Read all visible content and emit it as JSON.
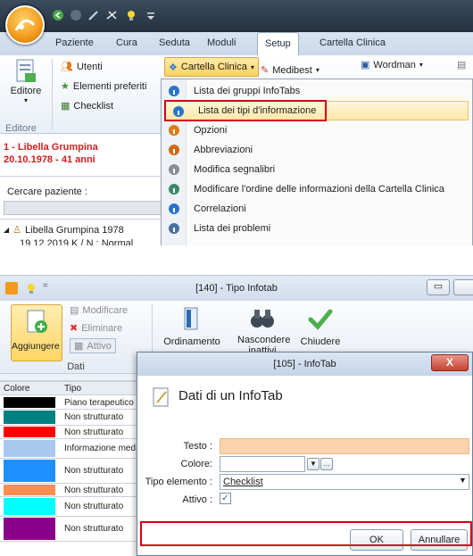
{
  "top": {
    "tabs": [
      "Paziente",
      "Cura",
      "Seduta",
      "Moduli",
      "Setup",
      "Cartella Clinica"
    ],
    "active_tab": "Setup",
    "ribbon": {
      "editor": "Editore",
      "editor_group": "Editore",
      "utenti": "Utenti",
      "elementi_preferiti": "Elementi preferiti",
      "checklist": "Checklist",
      "cartella_clinica": "Cartella Clinica",
      "medibest": "Medibest",
      "wordman": "Wordman"
    },
    "patient": {
      "line1": "1 - Libella Grumpina",
      "line2": "20.10.1978 - 41 anni",
      "search_label": "Cercare paziente :",
      "tree_root": "Libella Grumpina 1978",
      "tree_child": "19.12.2019 K / N : Normal"
    },
    "menu": [
      {
        "label": "Lista dei gruppi InfoTabs",
        "icon": "info-icon"
      },
      {
        "label": "Lista dei tipi d'informazione",
        "icon": "info-icon"
      },
      {
        "label": "Opzioni",
        "icon": "options-icon"
      },
      {
        "label": "Abbreviazioni",
        "icon": "abbreviations-icon"
      },
      {
        "label": "Modifica segnalibri",
        "icon": "bookmark-icon"
      },
      {
        "label": "Modificare l'ordine delle informazioni della  Cartella Clinica",
        "icon": "order-icon"
      },
      {
        "label": "Correlazioni",
        "icon": "info-icon"
      },
      {
        "label": "Lista dei problemi",
        "icon": "list-icon"
      }
    ]
  },
  "bottom": {
    "window_title": "[140] - Tipo Infotab",
    "ribbon": {
      "aggiungere": "Aggiungere",
      "modificare": "Modificare",
      "eliminare": "Eliminare",
      "attivo": "Attivo",
      "group_dati": "Dati",
      "ordinamento": "Ordinamento",
      "nascondere": "Nascondere inattivi",
      "chiudere": "Chiudere"
    },
    "grid": {
      "headers": [
        "Colore",
        "Tipo"
      ],
      "rows": [
        {
          "color": "#000000",
          "tipo": "Piano terapeutico"
        },
        {
          "color": "#008080",
          "tipo": "Non strutturato"
        },
        {
          "color": "#ff0000",
          "tipo": "Non strutturato"
        },
        {
          "color": "#a9c8f0",
          "tipo": "Informazione med"
        },
        {
          "color": "#1e90ff",
          "tipo": "Non strutturato"
        },
        {
          "color": "#ff8c50",
          "tipo": "Non strutturato"
        },
        {
          "color": "#00ffff",
          "tipo": "Non strutturato"
        },
        {
          "color": "#8b008b",
          "tipo": "Non strutturato"
        }
      ]
    },
    "dialog": {
      "title": "[105] - InfoTab",
      "heading": "Dati di un InfoTab",
      "testo_label": "Testo :",
      "testo_value": "",
      "colore_label": "Colore:",
      "tipo_label": "Tipo elemento :",
      "tipo_value": "Checklist",
      "attivo_label": "Attivo :",
      "attivo_checked": true,
      "ok": "OK",
      "annullare": "Annullare",
      "close": "X"
    }
  }
}
